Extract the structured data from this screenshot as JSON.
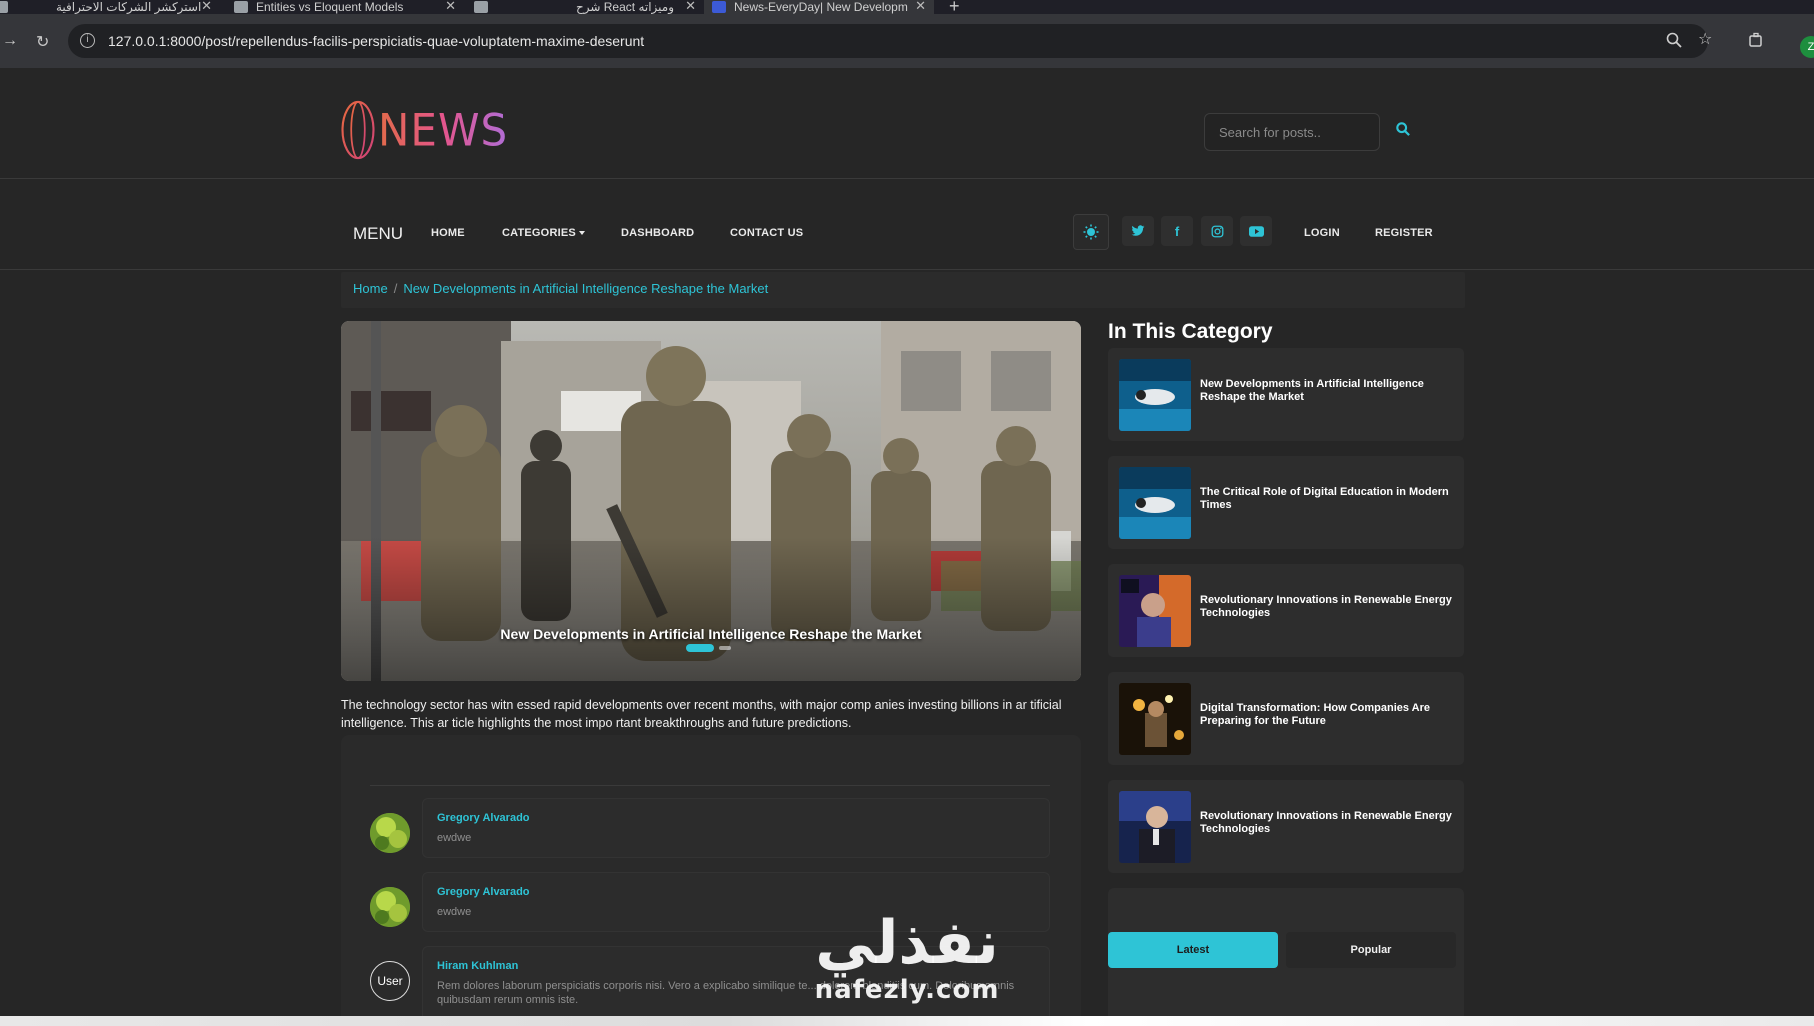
{
  "browser": {
    "tabs": [
      {
        "title": "استركشر الشركات الاحترافية"
      },
      {
        "title": "Entities vs Eloquent Models"
      },
      {
        "title": "شرح React وميزاته"
      },
      {
        "title": "News-EveryDay| New Developm"
      }
    ],
    "url": "127.0.0.1:8000/post/repellendus-facilis-perspiciatis-quae-voluptatem-maxime-deserunt",
    "profile_initial": "Z"
  },
  "header": {
    "logo_text": "NEWS",
    "search_placeholder": "Search for posts.."
  },
  "menu": {
    "title": "MENU",
    "links": [
      "HOME",
      "CATEGORIES",
      "DASHBOARD",
      "CONTACT US"
    ],
    "auth": [
      "LOGIN",
      "REGISTER"
    ],
    "social_icons": [
      "twitter-icon",
      "facebook-icon",
      "instagram-icon",
      "youtube-icon"
    ]
  },
  "breadcrumb": {
    "home": "Home",
    "current": "New Developments in Artificial Intelligence Reshape the Market"
  },
  "hero": {
    "caption": "New Developments in Artificial Intelligence Reshape the Market",
    "slide_count": 2,
    "active_slide": 1
  },
  "article": {
    "text": "The technology sector has witn essed rapid developments over recent months, with major comp anies investing billions in ar tificial intelligence. This ar ticle highlights the most impo rtant breakthroughs and future predictions."
  },
  "comments": [
    {
      "name": "Gregory Alvarado",
      "body": "ewdwe",
      "avatar": "photo"
    },
    {
      "name": "Gregory Alvarado",
      "body": "ewdwe",
      "avatar": "photo"
    },
    {
      "name": "Hiram Kuhlman",
      "body": "Rem dolores laborum perspiciatis corporis nisi. Vero a explicabo similique te... dolorem blanditiis cum. Doloribus omnis quibusdam rerum omnis iste.",
      "avatar": "User"
    }
  ],
  "sidebar": {
    "title": "In This Category",
    "items": [
      {
        "title": "New Developments in Artificial Intelligence Reshape the Market"
      },
      {
        "title": "The Critical Role of Digital Education in Modern Times"
      },
      {
        "title": "Revolutionary Innovations in Renewable Energy Technologies"
      },
      {
        "title": "Digital Transformation: How Companies Are Preparing for the Future"
      },
      {
        "title": "Revolutionary Innovations in Renewable Energy Technologies"
      }
    ],
    "tabs": [
      "Latest",
      "Popular"
    ]
  },
  "watermark": {
    "arabic": "نفذلي",
    "latin": "nafezly.com"
  },
  "colors": {
    "accent": "#2ec4d6",
    "background": "#262626",
    "card": "#2d2d2d"
  }
}
